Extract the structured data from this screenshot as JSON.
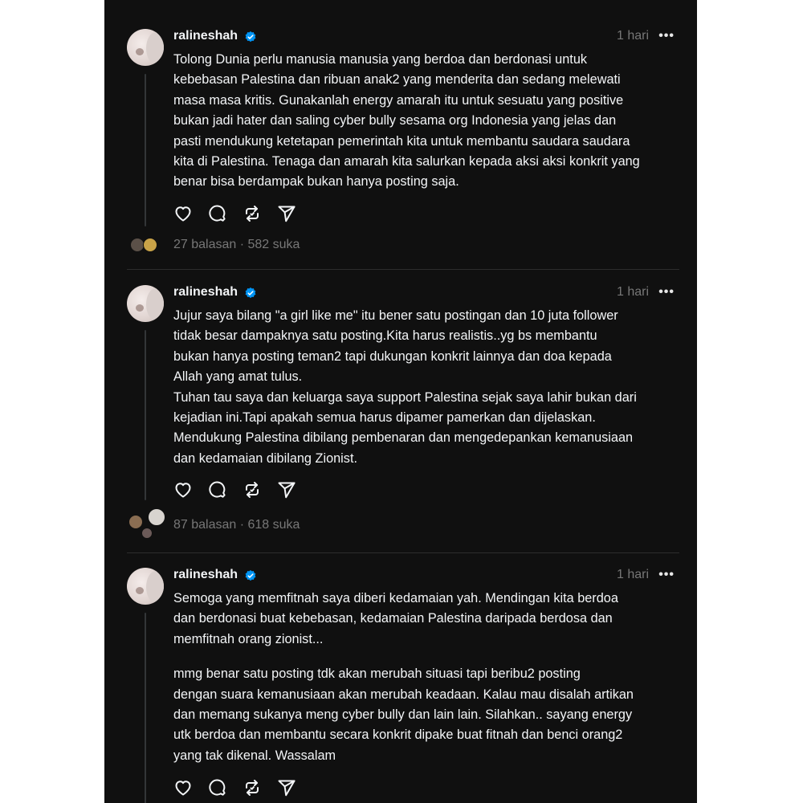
{
  "posts": [
    {
      "username": "ralineshah",
      "time": "1 hari",
      "more": "•••",
      "paragraphs": [
        "Tolong Dunia perlu manusia manusia yang berdoa dan berdonasi untuk\nkebebasan Palestina dan ribuan anak2 yang menderita dan sedang melewati\nmasa masa kritis. Gunakanlah energy amarah itu untuk sesuatu yang positive\nbukan jadi hater dan saling cyber bully sesama org Indonesia yang jelas dan\npasti mendukung ketetapan pemerintah kita untuk membantu saudara saudara\nkita di Palestina. Tenaga dan amarah kita salurkan kepada aksi aksi konkrit yang\nbenar bisa berdampak bukan hanya posting saja."
      ],
      "stats": "27 balasan · 582 suka"
    },
    {
      "username": "ralineshah",
      "time": "1 hari",
      "more": "•••",
      "paragraphs": [
        "Jujur saya bilang \"a girl like me\" itu bener satu postingan dan 10 juta follower\ntidak besar dampaknya satu posting.Kita harus realistis..yg bs membantu\nbukan hanya posting teman2 tapi dukungan konkrit lainnya dan doa kepada\nAllah yang amat tulus.\nTuhan tau saya dan keluarga saya support Palestina sejak saya lahir bukan dari\nkejadian ini.Tapi apakah semua harus dipamer pamerkan dan dijelaskan.\nMendukung Palestina dibilang pembenaran dan mengedepankan kemanusiaan\ndan kedamaian dibilang Zionist."
      ],
      "stats": "87 balasan · 618 suka"
    },
    {
      "username": "ralineshah",
      "time": "1 hari",
      "more": "•••",
      "paragraphs": [
        "Semoga yang memfitnah saya diberi kedamaian yah. Mendingan kita berdoa\ndan berdonasi buat kebebasan, kedamaian Palestina daripada berdosa dan\nmemfitnah orang zionist...",
        "mmg benar satu posting tdk akan merubah situasi tapi beribu2 posting\ndengan suara kemanusiaan akan merubah keadaan. Kalau mau disalah artikan\ndan memang sukanya meng cyber bully dan lain lain. Silahkan.. sayang energy\nutk berdoa dan membantu secara konkrit dipake buat fitnah dan benci orang2\nyang tak dikenal. Wassalam"
      ],
      "stats": ""
    }
  ],
  "icons": {
    "like": "heart-icon",
    "reply": "speech-bubble-icon",
    "repost": "repost-icon",
    "share": "send-icon",
    "verified": "verified-badge-icon"
  },
  "colors": {
    "background": "#101010",
    "text": "#f3f5f7",
    "muted": "#777777",
    "verified": "#0095f6"
  }
}
